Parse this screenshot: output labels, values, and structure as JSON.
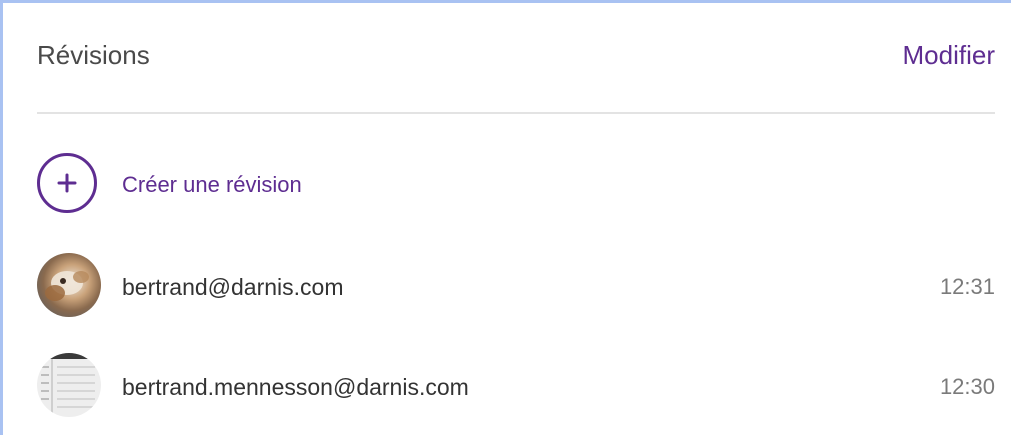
{
  "panel": {
    "title": "Révisions",
    "edit_label": "Modifier"
  },
  "create": {
    "icon": "plus-circle-icon",
    "label": "Créer une révision"
  },
  "revisions": [
    {
      "user": "bertrand@darnis.com",
      "time": "12:31",
      "avatar": "avatar-photo"
    },
    {
      "user": "bertrand.mennesson@darnis.com",
      "time": "12:30",
      "avatar": "avatar-document-thumbnail"
    }
  ],
  "colors": {
    "accent": "#5e2d91",
    "title_text": "#4a4a4a",
    "body_text": "#333333",
    "muted_text": "#7a7a7a",
    "divider": "#e3e3e3",
    "frame_border": "#a9c2f2"
  }
}
